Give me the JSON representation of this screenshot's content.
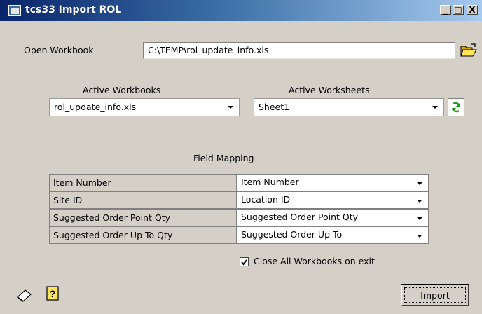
{
  "window": {
    "title": "tcs33 Import ROL",
    "min_label": "_",
    "max_label": "□",
    "close_label": "X"
  },
  "open_workbook": {
    "label": "Open Workbook",
    "value": "C:\\TEMP\\rol_update_info.xls"
  },
  "active_workbooks": {
    "label": "Active Workbooks",
    "selected": "rol_update_info.xls"
  },
  "active_worksheets": {
    "label": "Active Worksheets",
    "selected": "Sheet1"
  },
  "field_mapping": {
    "title": "Field Mapping",
    "rows": [
      {
        "field": "Item Number",
        "mapped": "Item Number"
      },
      {
        "field": "Site ID",
        "mapped": "Location ID"
      },
      {
        "field": "Suggested Order Point Qty",
        "mapped": "Suggested Order Point Qty"
      },
      {
        "field": "Suggested Order Up To Qty",
        "mapped": "Suggested Order Up To"
      }
    ]
  },
  "close_all": {
    "label": "Close All Workbooks on exit",
    "checked": true
  },
  "import_button": {
    "label": "Import"
  },
  "icons": {
    "open": "folder-open-icon",
    "refresh": "refresh-icon",
    "note": "note-icon",
    "help": "help-icon"
  }
}
